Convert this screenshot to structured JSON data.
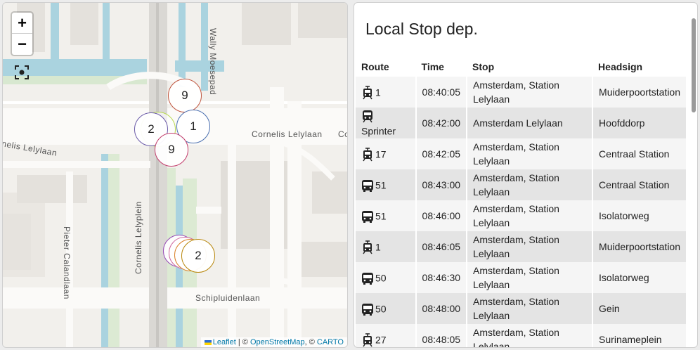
{
  "map": {
    "zoom_in": "+",
    "zoom_out": "−",
    "road_labels": {
      "wally": "Wally Moesepad",
      "cornelis_lelylaan": "Cornelis Lelylaan",
      "cornelis_lelylaan_cut": "Co",
      "cornelis_lelylaan_west": "nelis Lelylaan",
      "pieter_calandlaan": "Pieter Calandlaan",
      "cornelis_lelyplein": "Cornelis Lelyplein",
      "schipluidenlaan": "Schipluidenlaan"
    },
    "markers": [
      {
        "label": "9",
        "color": "#c0563f"
      },
      {
        "label": "2",
        "color": "#6a5aa8"
      },
      {
        "label": "1",
        "color": "#4a6fb0"
      },
      {
        "label": "9",
        "color": "#c23a6a"
      },
      {
        "label": "2",
        "color": "#b8860b"
      }
    ],
    "attribution": {
      "leaflet": "Leaflet",
      "sep1": " | © ",
      "osm": "OpenStreetMap",
      "sep2": ", © ",
      "carto": "CARTO"
    }
  },
  "panel": {
    "title": "Local Stop dep.",
    "columns": [
      "Route",
      "Time",
      "Stop",
      "Headsign"
    ],
    "rows": [
      {
        "icon": "tram-icon",
        "route": "1",
        "time": "08:40:05",
        "stop": "Amsterdam, Station Lelylaan",
        "headsign": "Muiderpoortstation"
      },
      {
        "icon": "train-icon",
        "route": "Sprinter",
        "time": "08:42:00",
        "stop": "Amsterdam Lelylaan",
        "headsign": "Hoofddorp"
      },
      {
        "icon": "tram-icon",
        "route": "17",
        "time": "08:42:05",
        "stop": "Amsterdam, Station Lelylaan",
        "headsign": "Centraal Station"
      },
      {
        "icon": "bus-icon",
        "route": "51",
        "time": "08:43:00",
        "stop": "Amsterdam, Station Lelylaan",
        "headsign": "Centraal Station"
      },
      {
        "icon": "bus-icon",
        "route": "51",
        "time": "08:46:00",
        "stop": "Amsterdam, Station Lelylaan",
        "headsign": "Isolatorweg"
      },
      {
        "icon": "tram-icon",
        "route": "1",
        "time": "08:46:05",
        "stop": "Amsterdam, Station Lelylaan",
        "headsign": "Muiderpoortstation"
      },
      {
        "icon": "bus-icon",
        "route": "50",
        "time": "08:46:30",
        "stop": "Amsterdam, Station Lelylaan",
        "headsign": "Isolatorweg"
      },
      {
        "icon": "bus-icon",
        "route": "50",
        "time": "08:48:00",
        "stop": "Amsterdam, Station Lelylaan",
        "headsign": "Gein"
      },
      {
        "icon": "tram-icon",
        "route": "27",
        "time": "08:48:05",
        "stop": "Amsterdam, Station Lelylaan",
        "headsign": "Surinameplein"
      }
    ]
  }
}
